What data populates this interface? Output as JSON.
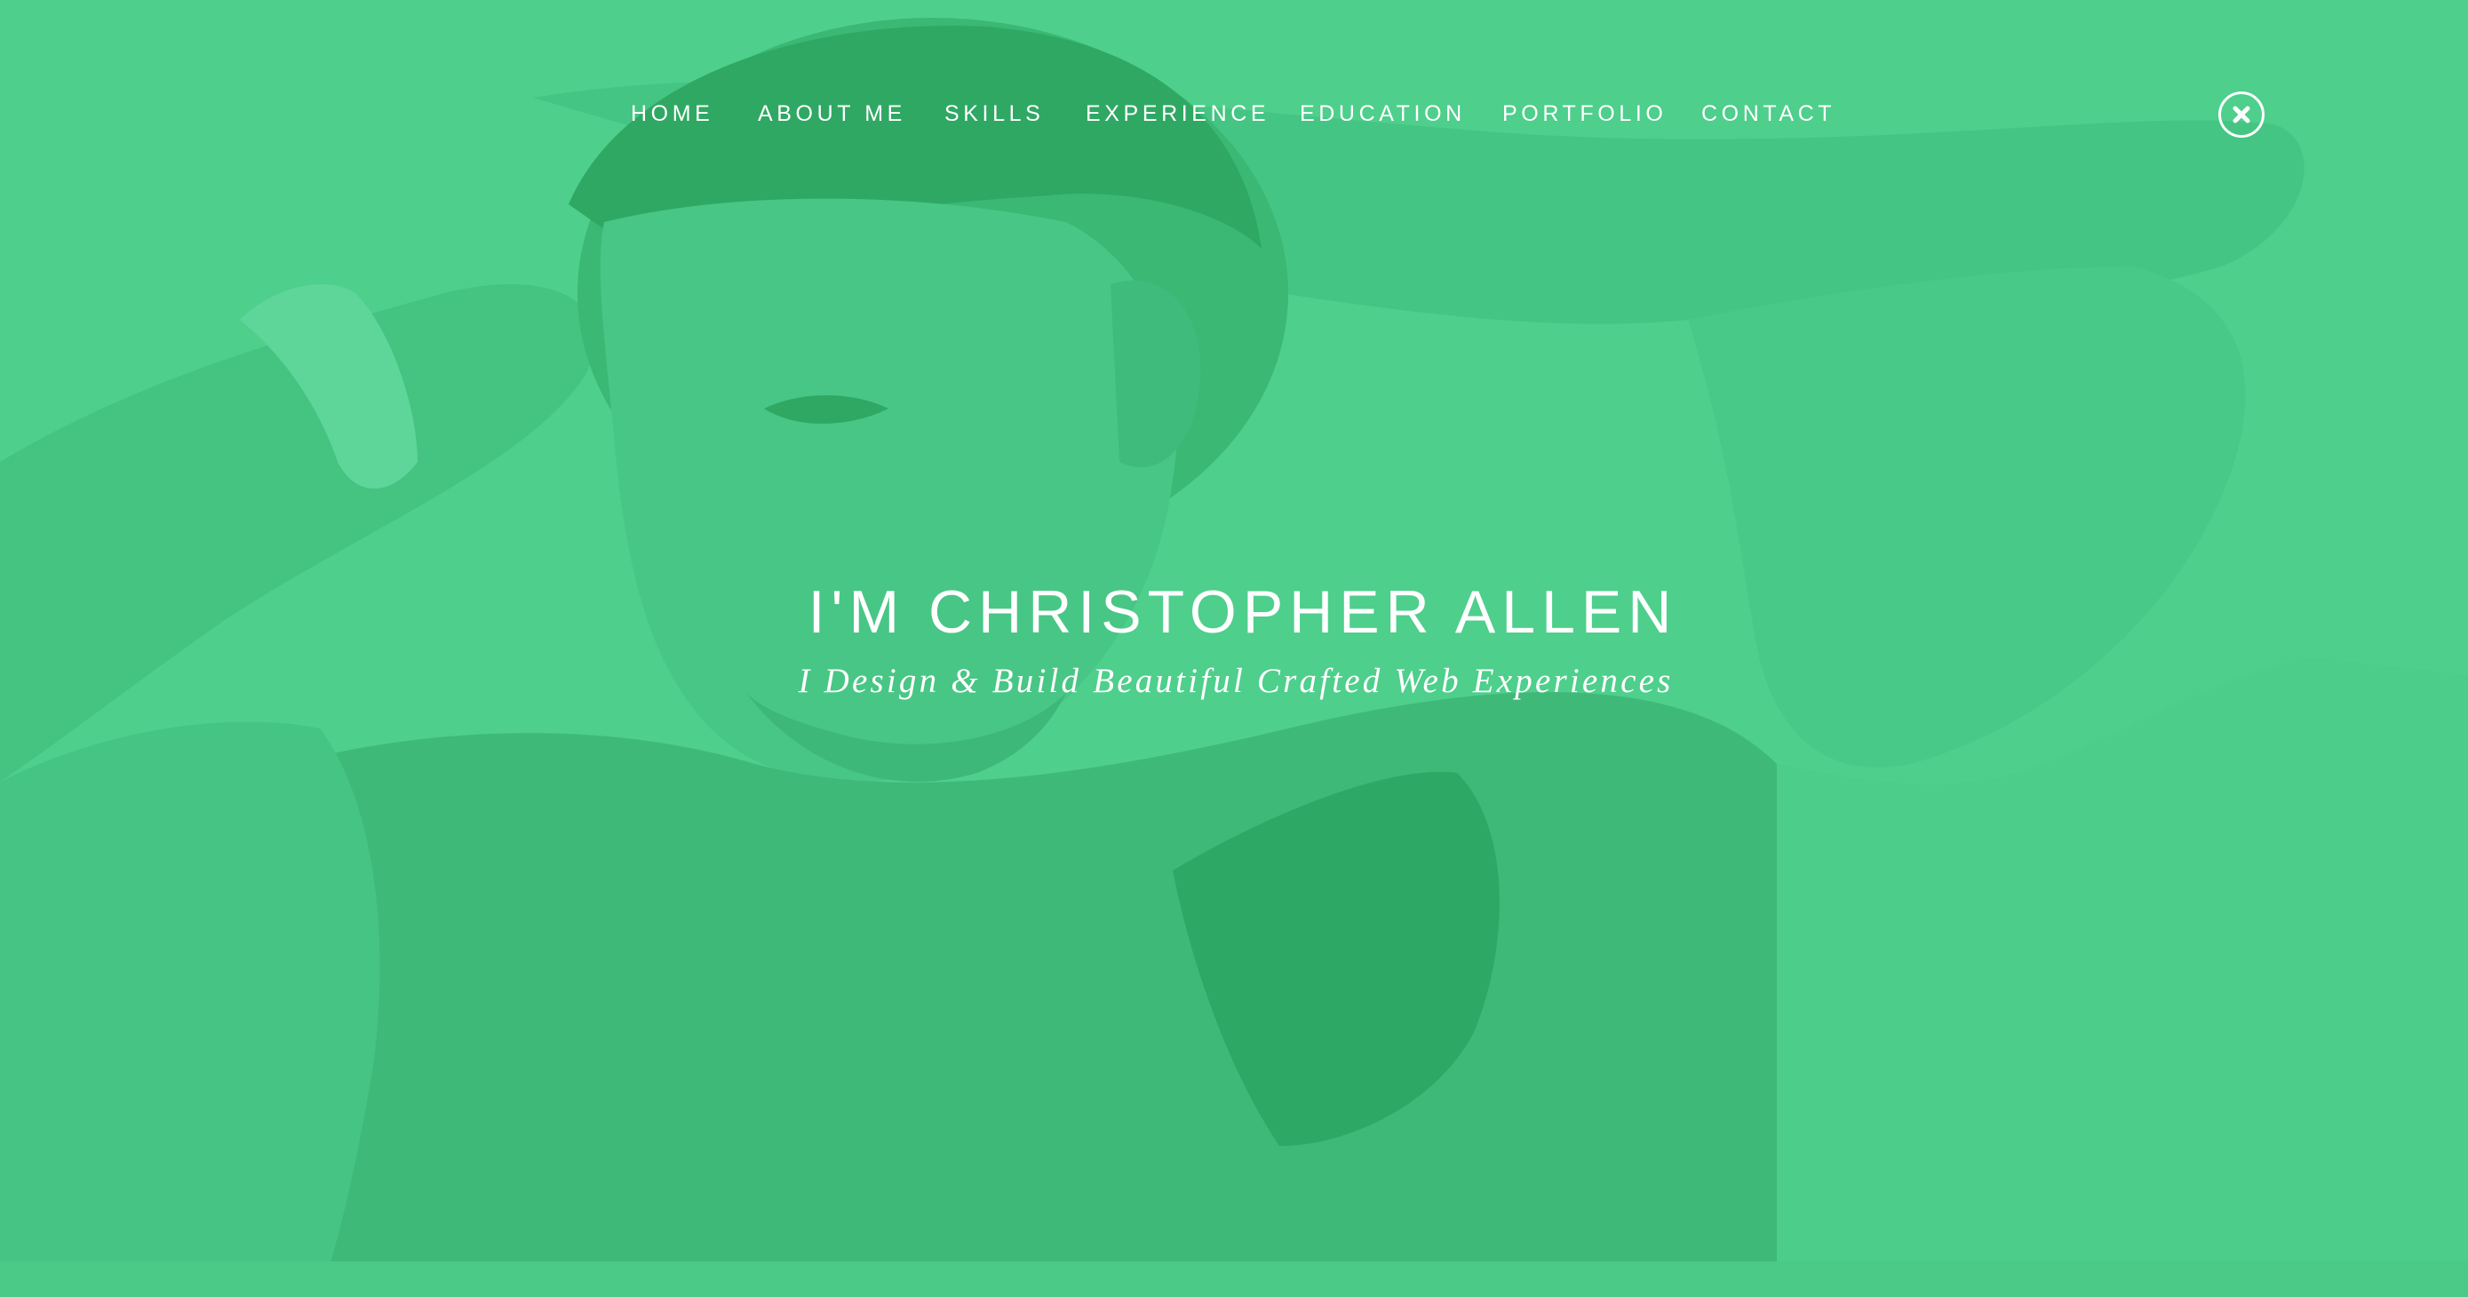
{
  "colors": {
    "overlay": "#4ecf8c",
    "shadow": "#2ea865",
    "text": "#ffffff"
  },
  "nav": {
    "items": [
      {
        "label": "HOME"
      },
      {
        "label": "ABOUT ME"
      },
      {
        "label": "SKILLS"
      },
      {
        "label": "EXPERIENCE"
      },
      {
        "label": "EDUCATION"
      },
      {
        "label": "PORTFOLIO"
      },
      {
        "label": "CONTACT"
      }
    ],
    "close_icon": "close-icon"
  },
  "hero": {
    "title": "I'M CHRISTOPHER ALLEN",
    "tagline": "I Design & Build Beautiful Crafted Web Experiences"
  }
}
